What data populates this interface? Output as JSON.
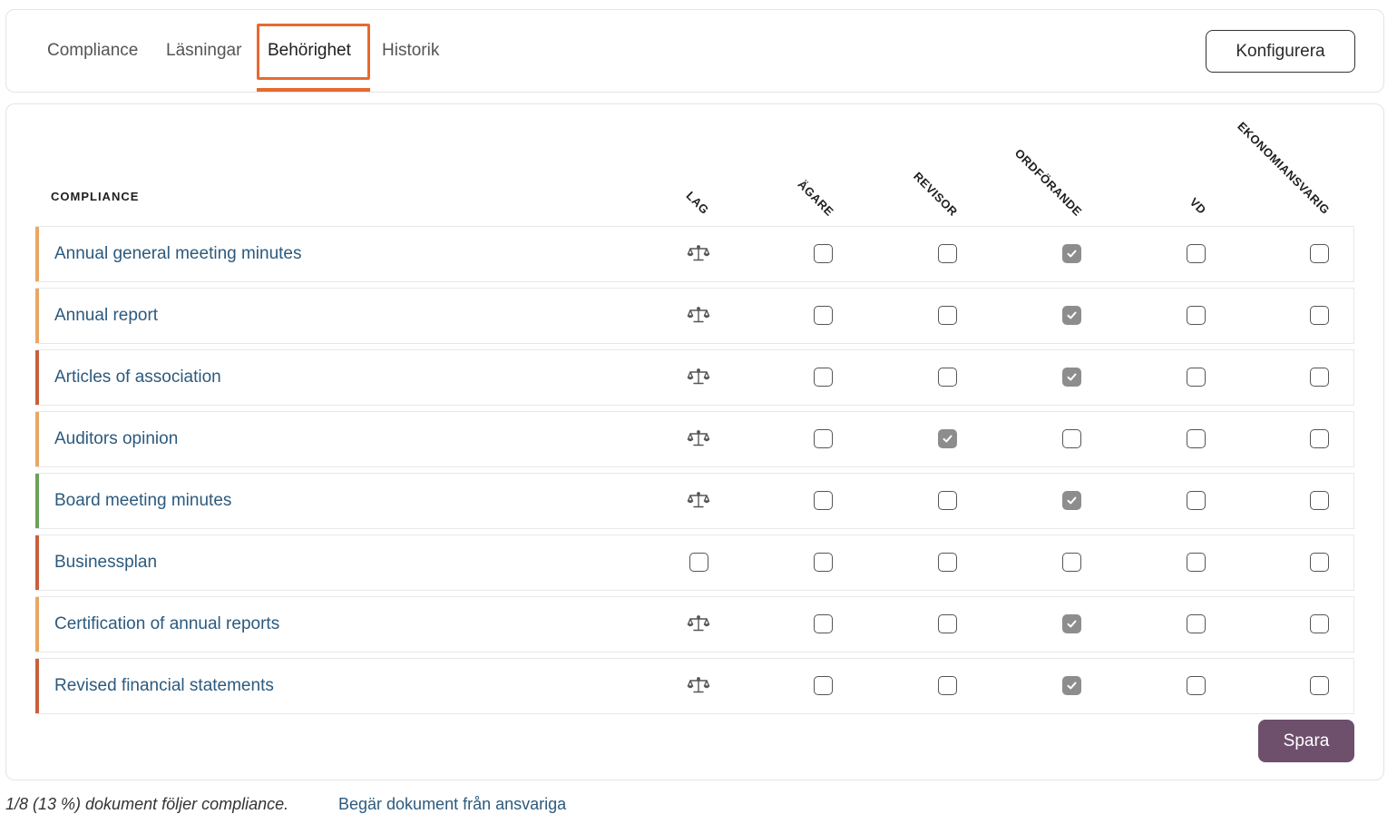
{
  "tabs": [
    {
      "label": "Compliance",
      "active": false
    },
    {
      "label": "Läsningar",
      "active": false
    },
    {
      "label": "Behörighet",
      "active": true
    },
    {
      "label": "Historik",
      "active": false
    }
  ],
  "configure_label": "Konfigurera",
  "table": {
    "title": "COMPLIANCE",
    "columns": [
      "LAG",
      "ÄGARE",
      "REVISOR",
      "ORDFÖRANDE",
      "VD",
      "EKONOMIANSVARIG"
    ],
    "rows": [
      {
        "name": "Annual general meeting minutes",
        "bar_color": "#e9a766",
        "law": true,
        "checks": [
          false,
          false,
          true,
          false,
          false
        ]
      },
      {
        "name": "Annual report",
        "bar_color": "#e9a766",
        "law": true,
        "checks": [
          false,
          false,
          true,
          false,
          false
        ]
      },
      {
        "name": "Articles of association",
        "bar_color": "#c8603c",
        "law": true,
        "checks": [
          false,
          false,
          true,
          false,
          false
        ]
      },
      {
        "name": "Auditors opinion",
        "bar_color": "#e9a766",
        "law": true,
        "checks": [
          false,
          true,
          false,
          false,
          false
        ]
      },
      {
        "name": "Board meeting minutes",
        "bar_color": "#6aa25b",
        "law": true,
        "checks": [
          false,
          false,
          true,
          false,
          false
        ]
      },
      {
        "name": "Businessplan",
        "bar_color": "#c8603c",
        "law": false,
        "checks": [
          false,
          false,
          false,
          false,
          false
        ]
      },
      {
        "name": "Certification of annual reports",
        "bar_color": "#e9a766",
        "law": true,
        "checks": [
          false,
          false,
          true,
          false,
          false
        ]
      },
      {
        "name": "Revised financial statements",
        "bar_color": "#c8603c",
        "law": true,
        "checks": [
          false,
          false,
          true,
          false,
          false
        ]
      }
    ]
  },
  "save_label": "Spara",
  "footer": {
    "status": "1/8 (13 %) dokument följer compliance.",
    "link": "Begär dokument från ansvariga"
  }
}
